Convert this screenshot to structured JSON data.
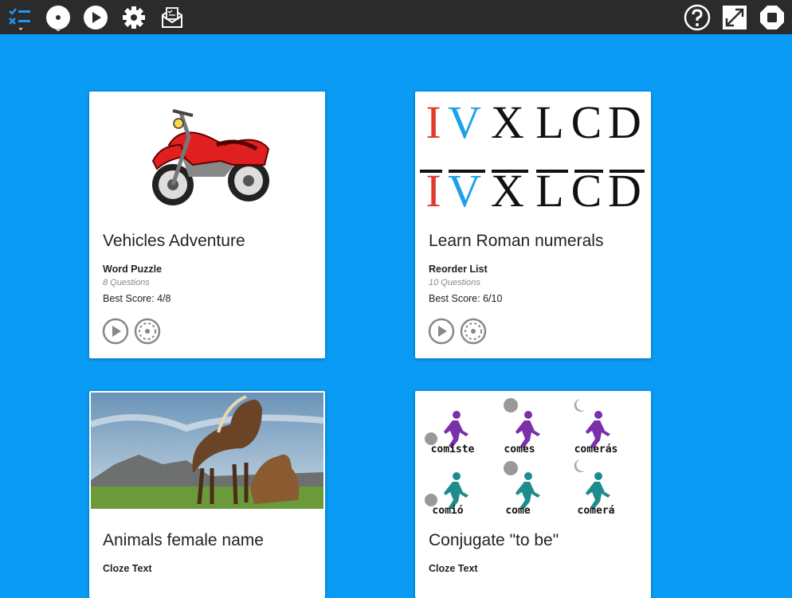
{
  "toolbar": {
    "left_icons": [
      "checklist-icon",
      "disc-icon",
      "play-icon",
      "gear-icon",
      "mail-icon"
    ],
    "right_icons": [
      "help-icon",
      "fullscreen-icon",
      "stop-icon"
    ]
  },
  "cards": [
    {
      "title": "Vehicles Adventure",
      "type": "Word Puzzle",
      "questions": "8 Questions",
      "score": "Best Score: 4/8"
    },
    {
      "title": "Learn Roman numerals",
      "type": "Reorder List",
      "questions": "10 Questions",
      "score": "Best Score: 6/10"
    },
    {
      "title": "Animals female name",
      "type": "Cloze Text",
      "questions": "",
      "score": ""
    },
    {
      "title": "Conjugate \"to be\"",
      "type": "Cloze Text",
      "questions": "",
      "score": ""
    }
  ],
  "roman": {
    "row1": [
      "I",
      "V",
      "X",
      "L",
      "C",
      "D"
    ],
    "row2": [
      "I",
      "V",
      "X",
      "L",
      "C",
      "D"
    ]
  },
  "conjugate": {
    "row1": [
      "comiste",
      "comes",
      "comerás"
    ],
    "row2": [
      "comió",
      "come",
      "comerá"
    ]
  },
  "colors": {
    "background": "#0a9cf5",
    "toolbar": "#2b2b2b",
    "roman_red": "#e03a2f",
    "roman_blue": "#1aa3e8",
    "purple": "#7b2fa8",
    "teal": "#1f8c8c"
  }
}
